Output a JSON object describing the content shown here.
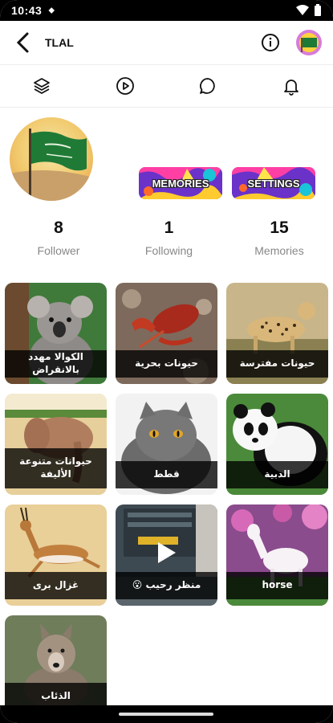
{
  "status": {
    "time": "10:43",
    "dot": "⬥"
  },
  "header": {
    "title": "TLAL"
  },
  "buttons": {
    "memories": "MEMORIES",
    "settings": "SETTINGS"
  },
  "stats": [
    {
      "value": "8",
      "label": "Follower"
    },
    {
      "value": "1",
      "label": "Following"
    },
    {
      "value": "15",
      "label": "Memories"
    }
  ],
  "grid": [
    {
      "caption": "الكوالا مهدد بالانقراض",
      "icon": "koala-photo"
    },
    {
      "caption": "حيونات بحرية",
      "icon": "lobster-photo"
    },
    {
      "caption": "حيونات مفترسة",
      "icon": "cheetah-photo"
    },
    {
      "caption": "حيوانات متنوعة الأليفة",
      "icon": "elephant-photo"
    },
    {
      "caption": "قطط",
      "icon": "cat-photo"
    },
    {
      "caption": "الدبية",
      "icon": "panda-photo"
    },
    {
      "caption": "غزال برى",
      "icon": "gazelle-photo"
    },
    {
      "caption": "منظر رحيب 😮",
      "icon": "video-thumbnail"
    },
    {
      "caption": "horse",
      "icon": "horse-photo"
    },
    {
      "caption": "الذئاب",
      "icon": "wolf-photo"
    }
  ],
  "colors": {
    "pill_bg": "#6a32c9",
    "caption_bg": "#000000"
  }
}
